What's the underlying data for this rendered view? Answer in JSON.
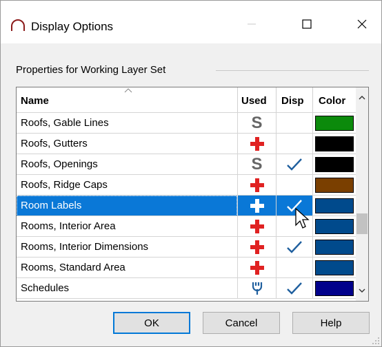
{
  "window": {
    "title": "Display Options"
  },
  "section": {
    "label": "Properties for  Working Layer Set"
  },
  "table": {
    "columns": [
      "Name",
      "Used",
      "Disp",
      "Color"
    ],
    "rows": [
      {
        "name": "Roofs, Gable Lines",
        "used": "S",
        "disp": false,
        "color": "#0b8a0b"
      },
      {
        "name": "Roofs, Gutters",
        "used": "plus",
        "disp": false,
        "color": "#000000"
      },
      {
        "name": "Roofs, Openings",
        "used": "S",
        "disp": true,
        "color": "#000000"
      },
      {
        "name": "Roofs, Ridge Caps",
        "used": "plus",
        "disp": false,
        "color": "#7a3f00"
      },
      {
        "name": "Room Labels",
        "used": "plus",
        "disp": true,
        "color": "#004a8c",
        "selected": true
      },
      {
        "name": "Rooms, Interior Area",
        "used": "plus",
        "disp": false,
        "color": "#004a8c"
      },
      {
        "name": "Rooms, Interior Dimensions",
        "used": "plus",
        "disp": true,
        "color": "#004a8c"
      },
      {
        "name": "Rooms, Standard Area",
        "used": "plus",
        "disp": false,
        "color": "#004a8c"
      },
      {
        "name": "Schedules",
        "used": "wrench",
        "disp": true,
        "color": "#00008b"
      }
    ]
  },
  "buttons": {
    "ok": "OK",
    "cancel": "Cancel",
    "help": "Help"
  },
  "icons": {
    "app": "arch-icon",
    "used_plus": "red-plus-icon",
    "used_s": "s-icon",
    "used_wrench": "wrench-icon",
    "disp": "checkmark-icon"
  },
  "colors": {
    "accent": "#0a78d7",
    "plus": "#e02222",
    "check": "#1f5f9e"
  }
}
